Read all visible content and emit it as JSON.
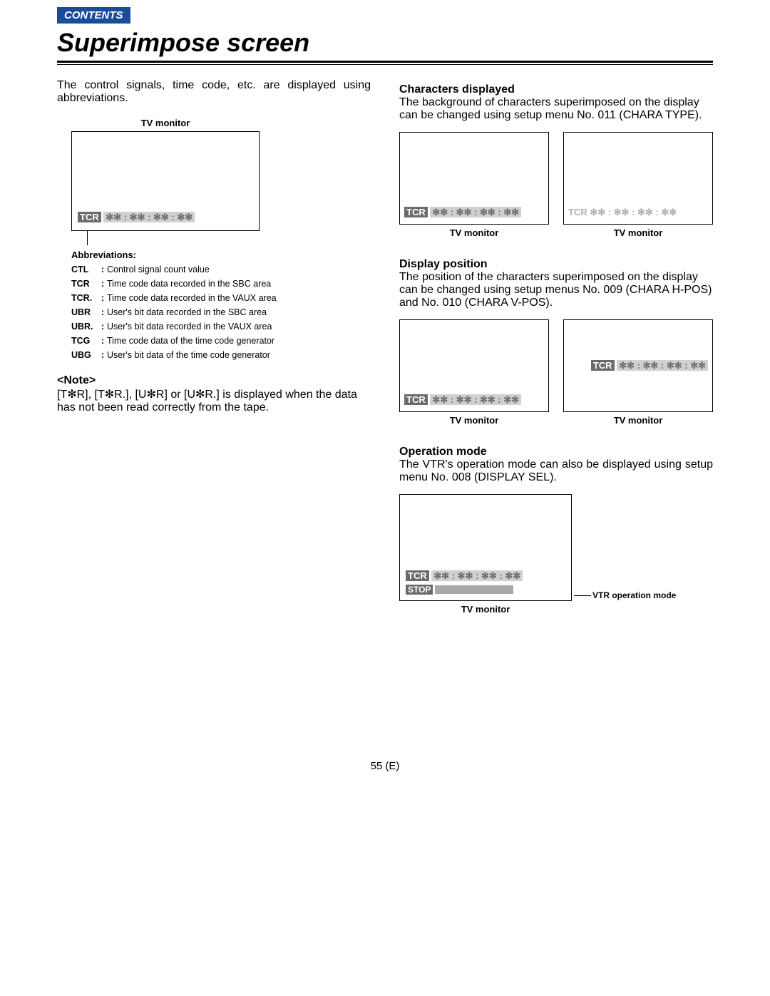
{
  "contents_label": "CONTENTS",
  "title": "Superimpose screen",
  "left": {
    "intro": "The control signals, time code, etc. are displayed using abbreviations.",
    "tv_label": "TV monitor",
    "overlay_tcr": "TCR",
    "overlay_time": "✻✻ : ✻✻ : ✻✻ : ✻✻",
    "abbr_head": "Abbreviations:",
    "abbrs": [
      {
        "k": "CTL",
        "v": "Control signal count value"
      },
      {
        "k": "TCR",
        "v": "Time code data recorded in the SBC area"
      },
      {
        "k": "TCR.",
        "v": "Time code data recorded in the VAUX area"
      },
      {
        "k": "UBR",
        "v": "User's bit data recorded in the SBC area"
      },
      {
        "k": "UBR.",
        "v": "User's bit data recorded in the VAUX area"
      },
      {
        "k": "TCG",
        "v": "Time code data of the time code generator"
      },
      {
        "k": "UBG",
        "v": "User's bit data of the time code generator"
      }
    ],
    "note_head": "<Note>",
    "note_body": "[T✻R], [T✻R.], [U✻R] or [U✻R.] is displayed when the data has not been read correctly from the tape."
  },
  "right": {
    "chars_head": "Characters displayed",
    "chars_body": "The background of characters superimposed on the display can be changed using setup menu No. 011 (CHARA TYPE).",
    "tv_label": "TV monitor",
    "overlay_tcr": "TCR",
    "overlay_time": "✻✻ : ✻✻ : ✻✻ : ✻✻",
    "disp_head": "Display position",
    "disp_body": "The position of the characters superimposed on the display can be changed using setup menus No. 009 (CHARA H-POS) and No. 010 (CHARA V-POS).",
    "op_head": "Operation mode",
    "op_body": "The VTR's operation mode can also be displayed using setup menu No. 008 (DISPLAY SEL).",
    "op_stop": "STOP",
    "op_callout": "VTR operation mode"
  },
  "page_num": "55 (E)"
}
